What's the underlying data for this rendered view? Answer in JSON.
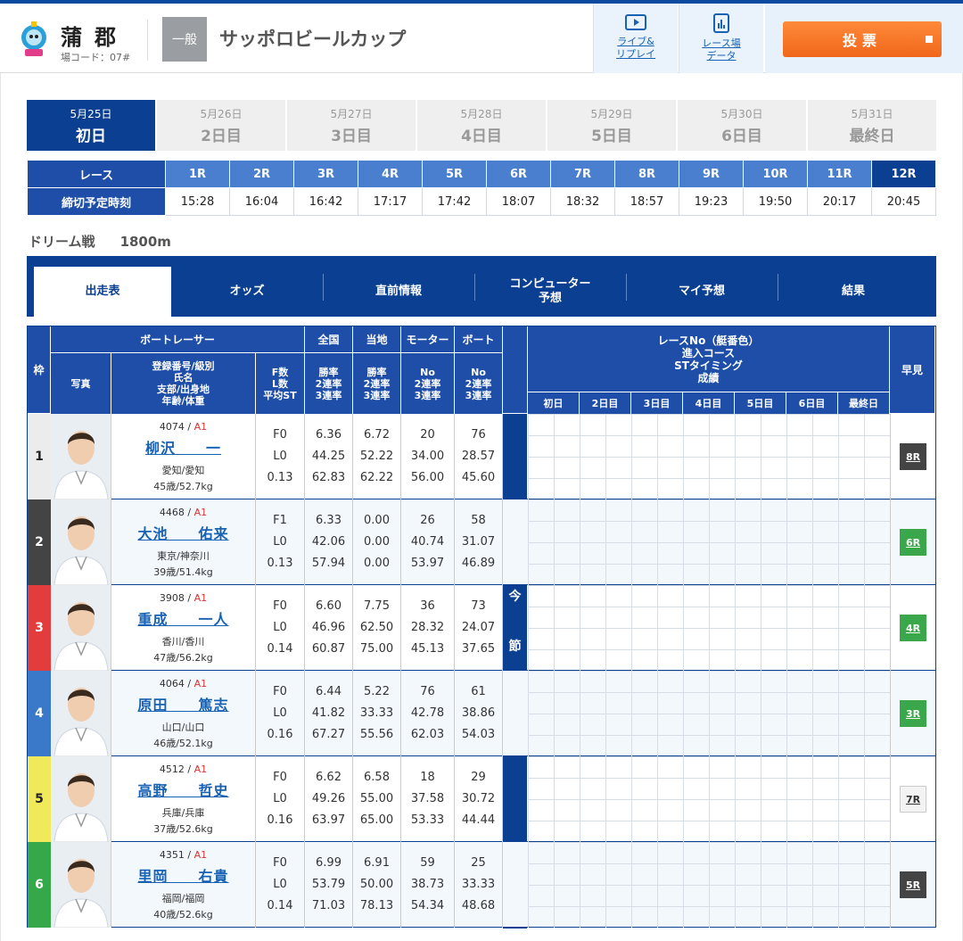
{
  "header": {
    "venue": "蒲郡",
    "venue_code": "場コード：07#",
    "grade": "一般",
    "race_name": "サッポロビールカップ",
    "links": [
      {
        "label": "ライブ&\nリプレイ",
        "icon": "play-icon"
      },
      {
        "label": "レース場\nデータ",
        "icon": "chart-doc-icon"
      }
    ],
    "vote_label": "投票"
  },
  "days": [
    {
      "date": "5月25日",
      "name": "初日",
      "active": true
    },
    {
      "date": "5月26日",
      "name": "2日目"
    },
    {
      "date": "5月27日",
      "name": "3日目"
    },
    {
      "date": "5月28日",
      "name": "4日目"
    },
    {
      "date": "5月29日",
      "name": "5日目"
    },
    {
      "date": "5月30日",
      "name": "6日目"
    },
    {
      "date": "5月31日",
      "name": "最終日"
    }
  ],
  "schedule": {
    "race_label": "レース",
    "deadline_label": "締切予定時刻",
    "races": [
      "1R",
      "2R",
      "3R",
      "4R",
      "5R",
      "6R",
      "7R",
      "8R",
      "9R",
      "10R",
      "11R",
      "12R"
    ],
    "times": [
      "15:28",
      "16:04",
      "16:42",
      "17:17",
      "17:42",
      "18:07",
      "18:32",
      "18:57",
      "19:23",
      "19:50",
      "20:17",
      "20:45"
    ],
    "current": "12R"
  },
  "race_info": {
    "type": "ドリーム戦",
    "distance": "1800m"
  },
  "tabs": [
    "出走表",
    "オッズ",
    "直前情報",
    "コンピューター\n予想",
    "マイ予想",
    "結果"
  ],
  "table_headers": {
    "waku": "枠",
    "boatracer": "ボートレーサー",
    "photo": "写真",
    "reg": "登録番号/級別\n氏名\n支部/出身地\n年齢/体重",
    "f": "F数\nL数\n平均ST",
    "zenkoku": "全国",
    "tochi": "当地",
    "motor": "モーター",
    "boat": "ボート",
    "rate_sub": "勝率\n2連率\n3連率",
    "no_sub": "No\n2連率\n3連率",
    "series": "レースNo（艇番色）\n進入コース\nSTタイミング\n成績",
    "series_days": [
      "初日",
      "2日目",
      "3日目",
      "4日目",
      "5日目",
      "6日目",
      "最終日"
    ],
    "hayami": "早見",
    "sensei": "今節成績"
  },
  "racers": [
    {
      "waku": "1",
      "reg": "4074",
      "cls": "A1",
      "name": "柳沢　　一",
      "from": "愛知/愛知",
      "age": "45歳/52.7kg",
      "f": [
        "F0",
        "L0",
        "0.13"
      ],
      "zenkoku": [
        "6.36",
        "44.25",
        "62.83"
      ],
      "tochi": [
        "6.72",
        "52.22",
        "62.22"
      ],
      "motor": [
        "20",
        "34.00",
        "56.00"
      ],
      "boat": [
        "76",
        "28.57",
        "45.60"
      ],
      "hayami": "8R",
      "hstyle": "dark",
      "color": "#ececec",
      "tcolor": "#222"
    },
    {
      "waku": "2",
      "reg": "4468",
      "cls": "A1",
      "name": "大池　　佑来",
      "from": "東京/神奈川",
      "age": "39歳/51.4kg",
      "f": [
        "F1",
        "L0",
        "0.13"
      ],
      "zenkoku": [
        "6.33",
        "42.06",
        "57.94"
      ],
      "tochi": [
        "0.00",
        "0.00",
        "0.00"
      ],
      "motor": [
        "26",
        "40.74",
        "53.97"
      ],
      "boat": [
        "58",
        "31.07",
        "46.89"
      ],
      "hayami": "6R",
      "hstyle": "green",
      "color": "#444",
      "tcolor": "#fff"
    },
    {
      "waku": "3",
      "reg": "3908",
      "cls": "A1",
      "name": "重成　　一人",
      "from": "香川/香川",
      "age": "47歳/56.2kg",
      "f": [
        "F0",
        "L0",
        "0.14"
      ],
      "zenkoku": [
        "6.60",
        "46.96",
        "60.87"
      ],
      "tochi": [
        "7.75",
        "62.50",
        "75.00"
      ],
      "motor": [
        "36",
        "28.32",
        "45.13"
      ],
      "boat": [
        "73",
        "24.07",
        "37.65"
      ],
      "hayami": "4R",
      "hstyle": "green",
      "color": "#e23c3c",
      "tcolor": "#fff"
    },
    {
      "waku": "4",
      "reg": "4064",
      "cls": "A1",
      "name": "原田　　篤志",
      "from": "山口/山口",
      "age": "46歳/52.1kg",
      "f": [
        "F0",
        "L0",
        "0.16"
      ],
      "zenkoku": [
        "6.44",
        "41.82",
        "67.27"
      ],
      "tochi": [
        "5.22",
        "33.33",
        "55.56"
      ],
      "motor": [
        "76",
        "42.78",
        "62.03"
      ],
      "boat": [
        "61",
        "38.86",
        "54.03"
      ],
      "hayami": "3R",
      "hstyle": "green",
      "color": "#3a78c9",
      "tcolor": "#fff"
    },
    {
      "waku": "5",
      "reg": "4512",
      "cls": "A1",
      "name": "高野　　哲史",
      "from": "兵庫/兵庫",
      "age": "37歳/52.6kg",
      "f": [
        "F0",
        "L0",
        "0.16"
      ],
      "zenkoku": [
        "6.62",
        "49.26",
        "63.97"
      ],
      "tochi": [
        "6.58",
        "55.00",
        "65.00"
      ],
      "motor": [
        "18",
        "37.58",
        "53.33"
      ],
      "boat": [
        "29",
        "30.72",
        "44.44"
      ],
      "hayami": "7R",
      "hstyle": "light",
      "color": "#f0ea5a",
      "tcolor": "#222"
    },
    {
      "waku": "6",
      "reg": "4351",
      "cls": "A1",
      "name": "里岡　　右貴",
      "from": "福岡/福岡",
      "age": "40歳/52.6kg",
      "f": [
        "F0",
        "L0",
        "0.14"
      ],
      "zenkoku": [
        "6.99",
        "53.79",
        "71.03"
      ],
      "tochi": [
        "6.91",
        "50.00",
        "78.13"
      ],
      "motor": [
        "59",
        "38.73",
        "54.34"
      ],
      "boat": [
        "25",
        "33.33",
        "48.68"
      ],
      "hayami": "5R",
      "hstyle": "dark",
      "color": "#35a84a",
      "tcolor": "#fff"
    }
  ]
}
